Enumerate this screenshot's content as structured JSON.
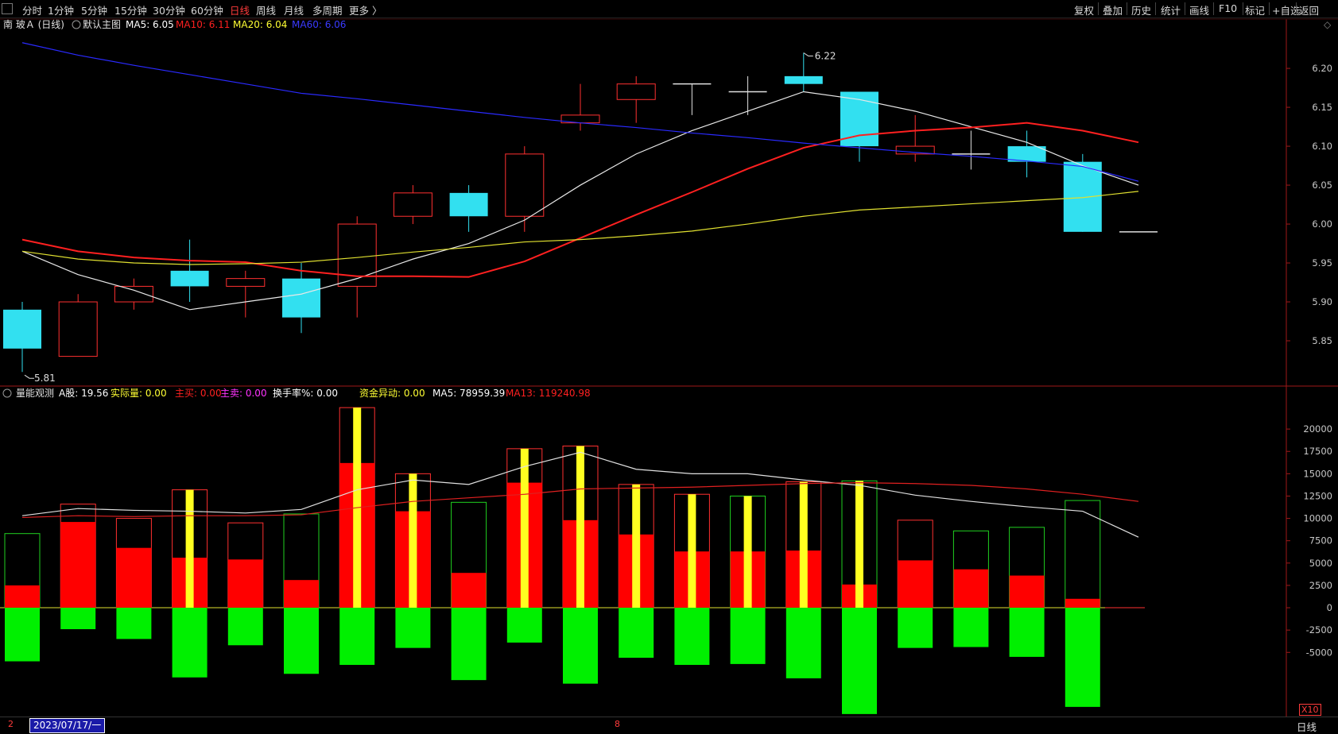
{
  "toolbar": {
    "periods": [
      "分时",
      "1分钟",
      "5分钟",
      "15分钟",
      "30分钟",
      "60分钟",
      "日线",
      "周线",
      "月线",
      "多周期",
      "更多 〉"
    ],
    "active_period": "日线",
    "right_buttons": [
      "复权",
      "叠加",
      "历史",
      "统计",
      "画线",
      "F10",
      "标记",
      "+自选",
      "返回"
    ]
  },
  "main_panel": {
    "title": "南 玻Ａ (日线)",
    "subtitle": "默认主图",
    "indicators": [
      {
        "label": "MA5: 6.05",
        "color": "#ffffff"
      },
      {
        "label": "MA10: 6.11",
        "color": "#ff2020"
      },
      {
        "label": "MA20: 6.04",
        "color": "#ffff33"
      },
      {
        "label": "MA60: 6.06",
        "color": "#3a3aff"
      }
    ],
    "high_label": "6.22",
    "low_label": "5.81"
  },
  "volume_panel": {
    "title": "量能观测",
    "indicators": [
      {
        "label": "A股: 19.56",
        "color": "#ffffff"
      },
      {
        "label": "实际量: 0.00",
        "color": "#ffff33"
      },
      {
        "label": "主买: 0.00",
        "color": "#ff2020"
      },
      {
        "label": "主卖: 0.00",
        "color": "#ff33ff"
      },
      {
        "label": "换手率%: 0.00",
        "color": "#ffffff"
      },
      {
        "label": "资金异动: 0.00",
        "color": "#ffff33"
      },
      {
        "label": "MA5: 78959.39",
        "color": "#ffffff"
      },
      {
        "label": "MA13: 119240.98",
        "color": "#ff2020"
      }
    ],
    "multiplier": "X10"
  },
  "bottom": {
    "year_start": "2",
    "date": "2023/07/17/一",
    "month": "8",
    "period": "日线"
  },
  "chart_data": [
    {
      "type": "candlestick",
      "ylim": [
        5.8,
        6.245
      ],
      "y_ticks": [
        "6.20",
        "6.15",
        "6.10",
        "6.05",
        "6.00",
        "5.95",
        "5.90",
        "5.85"
      ],
      "candles": [
        {
          "o": 5.89,
          "c": 5.84,
          "h": 5.9,
          "l": 5.81
        },
        {
          "o": 5.83,
          "c": 5.9,
          "h": 5.91,
          "l": 5.83
        },
        {
          "o": 5.9,
          "c": 5.92,
          "h": 5.93,
          "l": 5.89
        },
        {
          "o": 5.94,
          "c": 5.92,
          "h": 5.98,
          "l": 5.9
        },
        {
          "o": 5.92,
          "c": 5.93,
          "h": 5.94,
          "l": 5.88
        },
        {
          "o": 5.93,
          "c": 5.88,
          "h": 5.95,
          "l": 5.86
        },
        {
          "o": 5.92,
          "c": 6.0,
          "h": 6.01,
          "l": 5.88
        },
        {
          "o": 6.01,
          "c": 6.04,
          "h": 6.05,
          "l": 6.0
        },
        {
          "o": 6.04,
          "c": 6.01,
          "h": 6.05,
          "l": 5.99
        },
        {
          "o": 6.01,
          "c": 6.09,
          "h": 6.1,
          "l": 5.99
        },
        {
          "o": 6.13,
          "c": 6.14,
          "h": 6.18,
          "l": 6.12
        },
        {
          "o": 6.16,
          "c": 6.18,
          "h": 6.19,
          "l": 6.13
        },
        {
          "o": 6.18,
          "c": 6.18,
          "h": 6.18,
          "l": 6.14
        },
        {
          "o": 6.17,
          "c": 6.17,
          "h": 6.19,
          "l": 6.14
        },
        {
          "o": 6.19,
          "c": 6.18,
          "h": 6.22,
          "l": 6.17
        },
        {
          "o": 6.17,
          "c": 6.1,
          "h": 6.17,
          "l": 6.08
        },
        {
          "o": 6.09,
          "c": 6.1,
          "h": 6.14,
          "l": 6.08
        },
        {
          "o": 6.09,
          "c": 6.09,
          "h": 6.12,
          "l": 6.07
        },
        {
          "o": 6.1,
          "c": 6.08,
          "h": 6.12,
          "l": 6.06
        },
        {
          "o": 6.08,
          "c": 5.99,
          "h": 6.09,
          "l": 5.99
        },
        {
          "o": 5.99,
          "c": 5.99,
          "h": 5.99,
          "l": 5.99
        }
      ],
      "series": [
        {
          "name": "MA5",
          "color": "#e8e8e8",
          "values": [
            5.965,
            5.935,
            5.915,
            5.89,
            5.9,
            5.91,
            5.93,
            5.955,
            5.975,
            6.005,
            6.05,
            6.09,
            6.12,
            6.145,
            6.17,
            6.16,
            6.145,
            6.125,
            6.105,
            6.075,
            6.05
          ]
        },
        {
          "name": "MA10",
          "color": "#ff2020",
          "values": [
            5.98,
            5.965,
            5.957,
            5.953,
            5.951,
            5.94,
            5.933,
            5.933,
            5.932,
            5.952,
            5.982,
            6.012,
            6.041,
            6.071,
            6.098,
            6.114,
            6.12,
            6.124,
            6.13,
            6.12,
            6.105
          ]
        },
        {
          "name": "MA20",
          "color": "#e0e030",
          "values": [
            5.965,
            5.955,
            5.95,
            5.948,
            5.949,
            5.951,
            5.957,
            5.964,
            5.97,
            5.977,
            5.98,
            5.985,
            5.991,
            6.0,
            6.01,
            6.018,
            6.022,
            6.026,
            6.03,
            6.034,
            6.042
          ]
        },
        {
          "name": "MA60",
          "color": "#2a2aff",
          "values": [
            6.233,
            6.217,
            6.204,
            6.192,
            6.18,
            6.168,
            6.161,
            6.153,
            6.145,
            6.137,
            6.13,
            6.124,
            6.117,
            6.111,
            6.104,
            6.098,
            6.092,
            6.087,
            6.081,
            6.074,
            6.055
          ]
        }
      ]
    },
    {
      "type": "bar",
      "ylim": [
        -12000,
        22500
      ],
      "y_ticks": [
        20000,
        17500,
        15000,
        12500,
        10000,
        7500,
        5000,
        2500,
        0,
        -2500,
        -5000
      ],
      "bars": [
        {
          "pos": 2500,
          "box_top": 8300,
          "box_color": "green",
          "neg": -6000,
          "yellow": 0
        },
        {
          "pos": 9600,
          "box_top": 11600,
          "box_color": "red",
          "neg": -2400,
          "yellow": 0
        },
        {
          "pos": 6700,
          "box_top": 10000,
          "box_color": "red",
          "neg": -3500,
          "yellow": 0
        },
        {
          "pos": 5600,
          "box_top": 13200,
          "box_color": "red",
          "neg": -7800,
          "yellow": 13200
        },
        {
          "pos": 5400,
          "box_top": 9500,
          "box_color": "red",
          "neg": -4200,
          "yellow": 0
        },
        {
          "pos": 3100,
          "box_top": 10500,
          "box_color": "green",
          "neg": -7400,
          "yellow": 0
        },
        {
          "pos": 16200,
          "box_top": 22400,
          "box_color": "red",
          "neg": -6400,
          "yellow": 22400
        },
        {
          "pos": 10800,
          "box_top": 15000,
          "box_color": "red",
          "neg": -4500,
          "yellow": 15000
        },
        {
          "pos": 3900,
          "box_top": 11800,
          "box_color": "green",
          "neg": -8100,
          "yellow": 0
        },
        {
          "pos": 14000,
          "box_top": 17800,
          "box_color": "red",
          "neg": -3900,
          "yellow": 17800
        },
        {
          "pos": 9800,
          "box_top": 18100,
          "box_color": "red",
          "neg": -8500,
          "yellow": 18100
        },
        {
          "pos": 8200,
          "box_top": 13800,
          "box_color": "red",
          "neg": -5600,
          "yellow": 13800
        },
        {
          "pos": 6300,
          "box_top": 12700,
          "box_color": "red",
          "neg": -6400,
          "yellow": 12700
        },
        {
          "pos": 6300,
          "box_top": 12500,
          "box_color": "green",
          "neg": -6300,
          "yellow": 12500
        },
        {
          "pos": 6400,
          "box_top": 14100,
          "box_color": "red",
          "neg": -7900,
          "yellow": 14100
        },
        {
          "pos": 2600,
          "box_top": 14200,
          "box_color": "green",
          "neg": -11900,
          "yellow": 14200
        },
        {
          "pos": 5300,
          "box_top": 9800,
          "box_color": "red",
          "neg": -4500,
          "yellow": 0
        },
        {
          "pos": 4300,
          "box_top": 8600,
          "box_color": "green",
          "neg": -4400,
          "yellow": 0
        },
        {
          "pos": 3600,
          "box_top": 9000,
          "box_color": "green",
          "neg": -5500,
          "yellow": 0
        },
        {
          "pos": 1000,
          "box_top": 12000,
          "box_color": "green",
          "neg": -11100,
          "yellow": 0
        }
      ],
      "series": [
        {
          "name": "MA5",
          "color": "#e0e0e0",
          "values": [
            10300,
            11100,
            10900,
            10800,
            10600,
            11000,
            13200,
            14300,
            13800,
            15800,
            17400,
            15500,
            15000,
            15000,
            14300,
            13700,
            12600,
            11900,
            11300,
            10800,
            7900
          ]
        },
        {
          "name": "MA13",
          "color": "#e02020",
          "values": [
            10100,
            10300,
            10200,
            10300,
            10300,
            10400,
            11200,
            11900,
            12300,
            12700,
            13300,
            13400,
            13500,
            13700,
            13900,
            14000,
            13900,
            13700,
            13300,
            12700,
            11900
          ]
        }
      ]
    }
  ]
}
